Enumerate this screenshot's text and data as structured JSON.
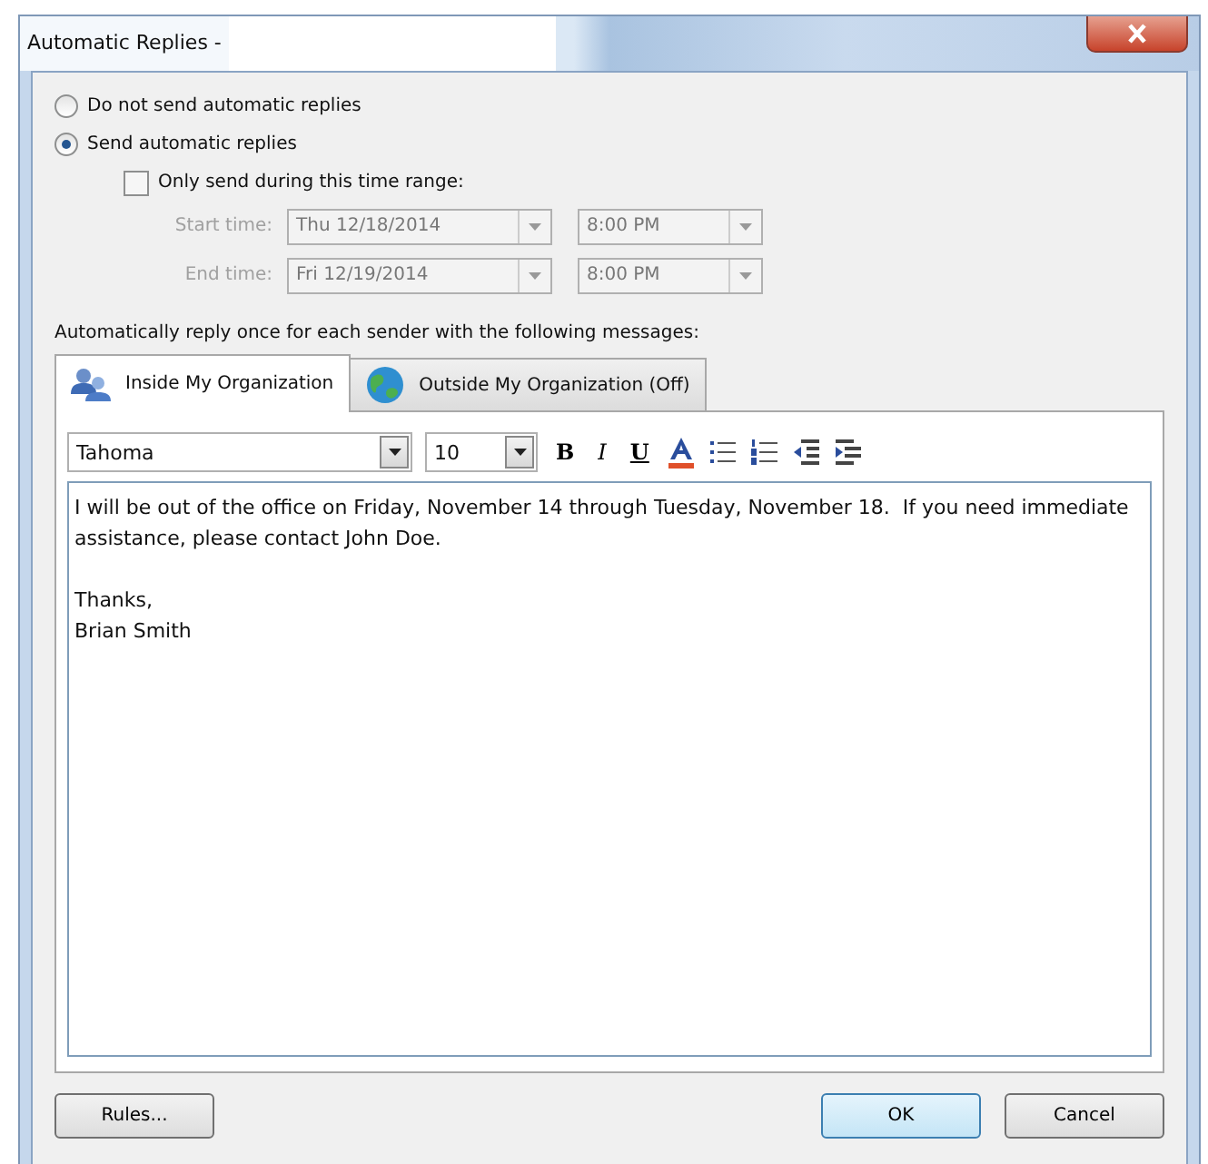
{
  "window": {
    "title": "Automatic Replies -"
  },
  "reply_mode": [
    {
      "label": "Do not send automatic replies",
      "selected": false
    },
    {
      "label": "Send automatic replies",
      "selected": true
    }
  ],
  "time_range": {
    "label": "Only send during this time range:",
    "checked": false
  },
  "times": [
    {
      "label": "Start time:",
      "date": "Thu 12/18/2014",
      "time": "8:00 PM",
      "disabled": true
    },
    {
      "label": "End time:",
      "date": "Fri 12/19/2014",
      "time": "8:00 PM",
      "disabled": true
    }
  ],
  "instruction": "Automatically reply once for each sender with the following messages:",
  "tabs": [
    {
      "label": "Inside My Organization",
      "kind": "people",
      "selected": true
    },
    {
      "label": "Outside My Organization (Off)",
      "kind": "globe",
      "selected": false
    }
  ],
  "toolbar": {
    "font": "Tahoma",
    "size": "10",
    "bold": "B",
    "italic": "I",
    "underline": "U"
  },
  "message": [
    "I will be out of the office on Friday, November 14 through Tuesday, November 18.  If you need immediate assistance, please contact John Doe.",
    "Thanks,\nBrian Smith"
  ],
  "buttons": {
    "left": "Rules...",
    "ok": "OK",
    "cancel": "Cancel"
  }
}
